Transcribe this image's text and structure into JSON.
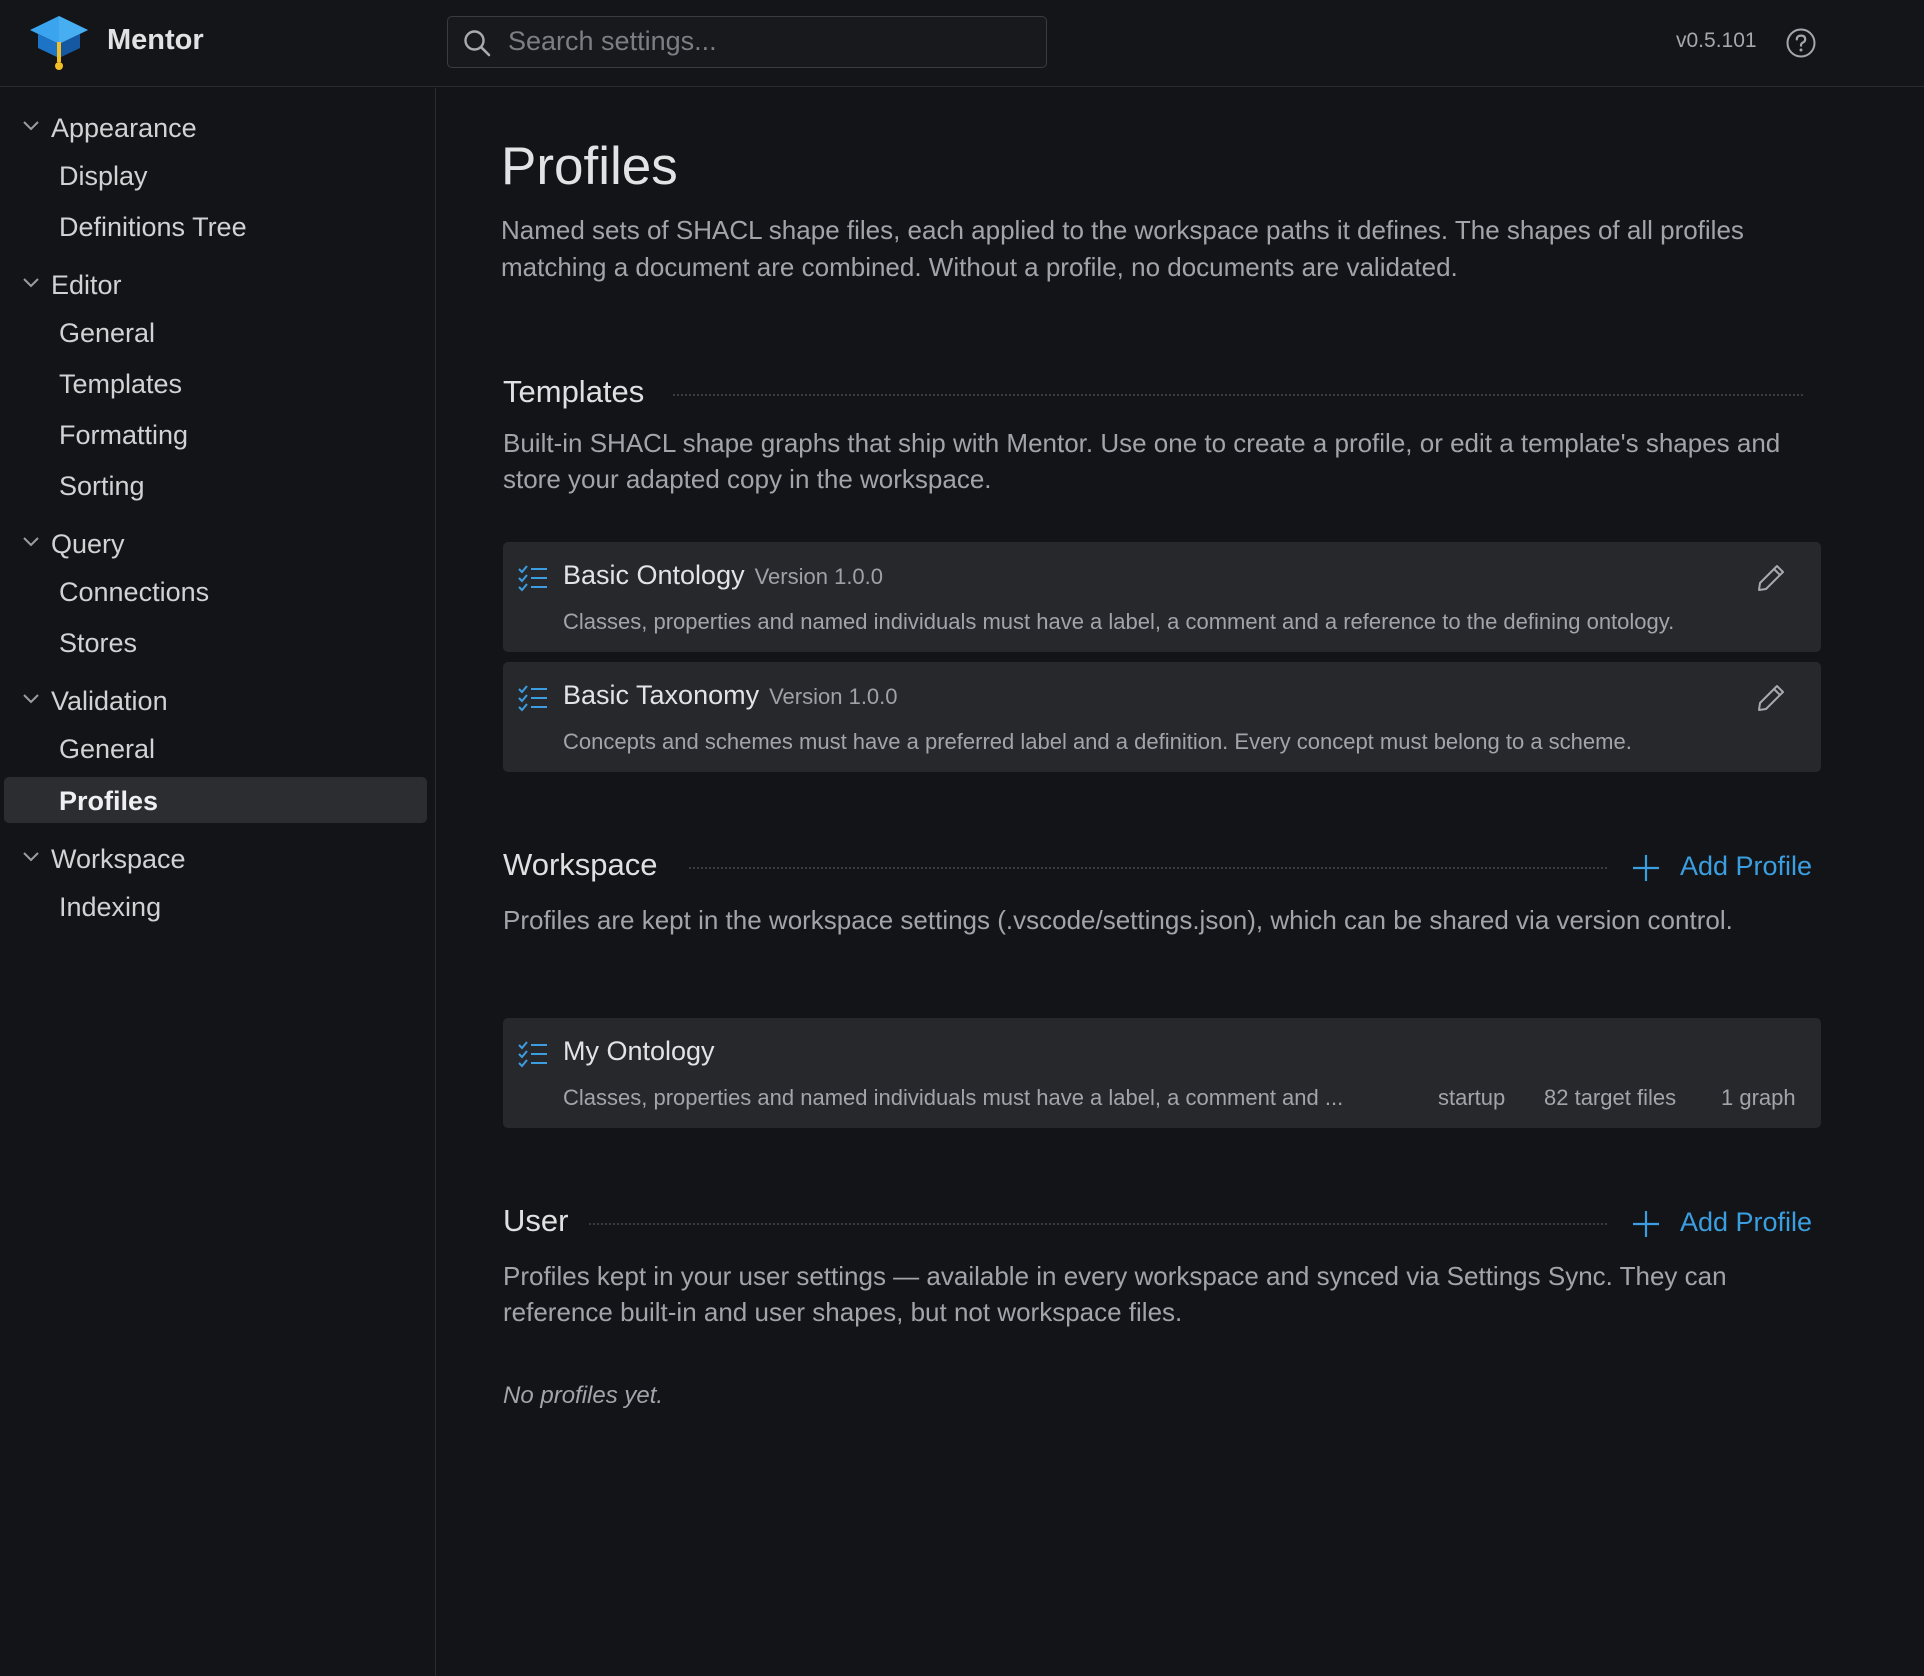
{
  "header": {
    "app_name": "Mentor",
    "search_placeholder": "Search settings...",
    "version": "v0.5.101"
  },
  "sidebar": {
    "groups": [
      {
        "label": "Appearance",
        "items": [
          "Display",
          "Definitions Tree"
        ]
      },
      {
        "label": "Editor",
        "items": [
          "General",
          "Templates",
          "Formatting",
          "Sorting"
        ]
      },
      {
        "label": "Query",
        "items": [
          "Connections",
          "Stores"
        ]
      },
      {
        "label": "Validation",
        "items": [
          "General",
          "Profiles"
        ]
      },
      {
        "label": "Workspace",
        "items": [
          "Indexing"
        ]
      }
    ],
    "active_item": "Profiles"
  },
  "main": {
    "title": "Profiles",
    "description": "Named sets of SHACL shape files, each applied to the workspace paths it defines. The shapes of all profiles matching a document are combined. Without a profile, no documents are validated.",
    "templates": {
      "title": "Templates",
      "description": "Built-in SHACL shape graphs that ship with Mentor. Use one to create a profile, or edit a template's shapes and store your adapted copy in the workspace.",
      "cards": [
        {
          "title": "Basic Ontology",
          "version": "Version 1.0.0",
          "description": "Classes, properties and named individuals must have a label, a comment and a reference to the defining ontology."
        },
        {
          "title": "Basic Taxonomy",
          "version": "Version 1.0.0",
          "description": "Concepts and schemes must have a preferred label and a definition. Every concept must belong to a scheme."
        }
      ]
    },
    "workspace": {
      "title": "Workspace",
      "add_label": "Add Profile",
      "description": "Profiles are kept in the workspace settings (.vscode/settings.json), which can be shared via version control.",
      "cards": [
        {
          "title": "My Ontology",
          "description": "Classes, properties and named individuals must have a label, a comment and ...",
          "meta": [
            "startup",
            "82 target files",
            "1 graph"
          ]
        }
      ]
    },
    "user": {
      "title": "User",
      "add_label": "Add Profile",
      "description": "Profiles kept in your user settings — available in every workspace and synced via Settings Sync. They can reference built-in and user shapes, but not workspace files.",
      "empty_text": "No profiles yet."
    }
  },
  "colors": {
    "background": "#131417",
    "card": "#27282c",
    "accent": "#3b9ee0",
    "active_nav": "#2c2d31"
  }
}
